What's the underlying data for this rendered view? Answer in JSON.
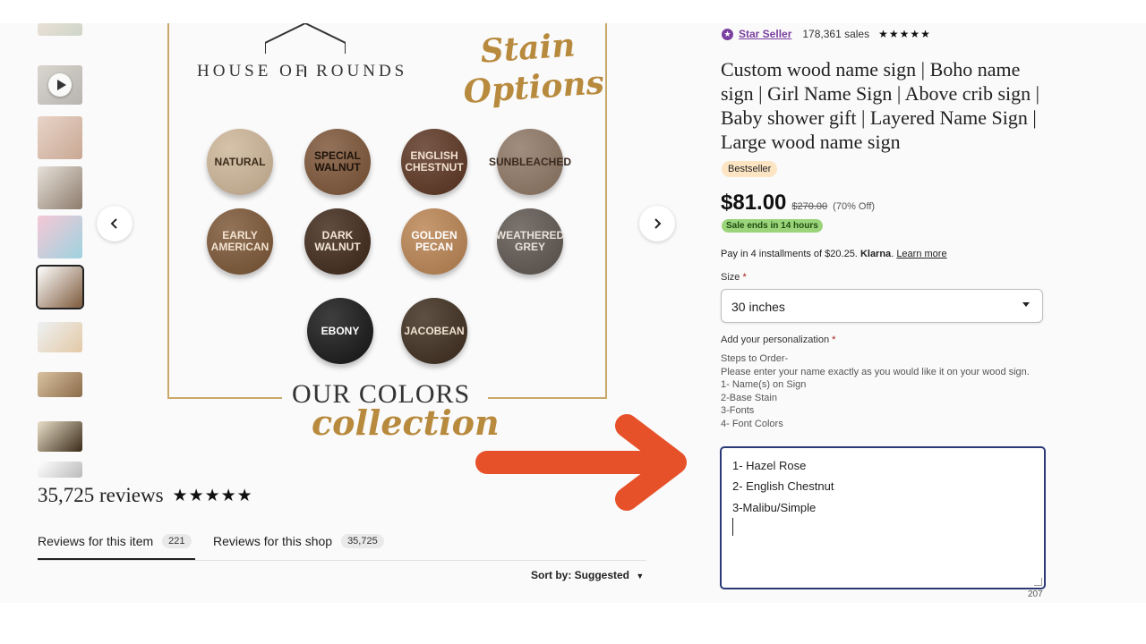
{
  "colors": {
    "star_seller": "#7b3fa0",
    "sale_tag_bg": "#9bd47a",
    "bestseller_bg": "#fde5c4",
    "focus_border": "#2b3a76",
    "arrow": "#e6512a",
    "gold": "#b88a3e"
  },
  "gallery": {
    "thumbnails": [
      {
        "name": "photo-1",
        "type": "image",
        "colors": [
          "#e9e0d7",
          "#cfd6c9"
        ]
      },
      {
        "name": "video",
        "type": "video",
        "colors": [
          "#d9d6d0",
          "#b7b4ae"
        ]
      },
      {
        "name": "photo-3",
        "type": "image",
        "colors": [
          "#e8d4c8",
          "#c9a894"
        ]
      },
      {
        "name": "photo-4",
        "type": "image",
        "colors": [
          "#e7e1da",
          "#8c7b6c"
        ]
      },
      {
        "name": "photo-5",
        "type": "image",
        "colors": [
          "#f6c7d5",
          "#9ed3e0"
        ]
      },
      {
        "name": "photo-6",
        "type": "image",
        "selected": true,
        "colors": [
          "#ffffff",
          "#7d5a3c"
        ]
      },
      {
        "name": "photo-7",
        "type": "image",
        "colors": [
          "#eef1f3",
          "#e3c9a6"
        ]
      },
      {
        "name": "photo-8",
        "type": "image",
        "colors": [
          "#d9c2a0",
          "#8b6b4a"
        ]
      },
      {
        "name": "photo-9",
        "type": "image",
        "colors": [
          "#e9dfc9",
          "#3a2b18"
        ]
      },
      {
        "name": "photo-10",
        "type": "image",
        "colors": [
          "#ffffff",
          "#bbbbbb"
        ]
      }
    ],
    "main": {
      "brand": "HOUSE OF ROUNDS",
      "heading_script": [
        "Stain",
        "Options"
      ],
      "swatches": [
        {
          "label": "NATURAL",
          "bg": "#cdb597",
          "fg": "#3b2a1a"
        },
        {
          "label": "SPECIAL WALNUT",
          "bg": "#7b5335",
          "fg": "#1e120a"
        },
        {
          "label": "ENGLISH CHESTNUT",
          "bg": "#5a3320",
          "fg": "#f1e0cf"
        },
        {
          "label": "SUNBLEACHED",
          "bg": "#8d7562",
          "fg": "#3a2a1f"
        },
        {
          "label": "EARLY AMERICAN",
          "bg": "#7a5433",
          "fg": "#f2e3d1"
        },
        {
          "label": "DARK WALNUT",
          "bg": "#3d2617",
          "fg": "#f3e6d6"
        },
        {
          "label": "GOLDEN PECAN",
          "bg": "#b98250",
          "fg": "#ffffff"
        },
        {
          "label": "WEATHERED GREY",
          "bg": "#5d554e",
          "fg": "#e9e2da"
        },
        {
          "label": "EBONY",
          "bg": "#141414",
          "fg": "#ffffff"
        },
        {
          "label": "JACOBEAN",
          "bg": "#3b2a1b",
          "fg": "#f0e2cf"
        }
      ],
      "footer_top": "OUR COLORS",
      "footer_script": "collection"
    }
  },
  "reviews": {
    "count_label": "35,725 reviews",
    "stars": "★★★★★",
    "tabs": [
      {
        "label": "Reviews for this item",
        "count": "221"
      },
      {
        "label": "Reviews for this shop",
        "count": "35,725"
      }
    ],
    "sort_label": "Sort by: Suggested"
  },
  "listing": {
    "star_seller": "Star Seller",
    "sales": "178,361 sales",
    "stars": "★★★★★",
    "title": "Custom wood name sign | Boho name sign | Girl Name Sign | Above crib sign | Baby shower gift | Layered Name Sign | Large wood name sign",
    "bestseller": "Bestseller",
    "price": "$81.00",
    "old_price": "$270.00",
    "discount": "(70% Off)",
    "sale_ends": "Sale ends in 14 hours",
    "installments_text": "Pay in 4 installments of $20.25.",
    "klarna": "Klarna",
    "learn_more": "Learn more",
    "size_label": "Size",
    "size_value": "30 inches",
    "personalization_label": "Add your personalization",
    "instructions": [
      "Steps to Order-",
      "Please enter your name exactly as you would like it on your wood sign.",
      "1- Name(s) on Sign",
      "2-Base Stain",
      "3-Fonts",
      "4- Font Colors"
    ],
    "textarea_lines": [
      "1- Hazel Rose",
      "2- English Chestnut",
      "3-Malibu/Simple"
    ],
    "char_count": "207"
  }
}
